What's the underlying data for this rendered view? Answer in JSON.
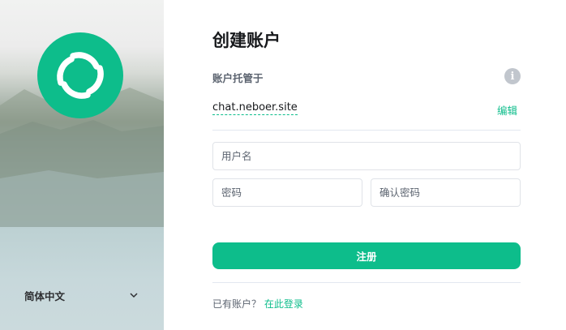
{
  "left_panel": {
    "logo_icon": "element-logo-icon",
    "language_label": "简体中文",
    "dropdown_icon": "chevron-down-icon"
  },
  "main": {
    "title": "创建账户",
    "homeserver_label": "账户托管于",
    "info_icon_glyph": "i",
    "homeserver_value": "chat.neboer.site",
    "edit_label": "编辑",
    "username_placeholder": "用户名",
    "password_placeholder": "密码",
    "confirm_password_placeholder": "确认密码",
    "register_label": "注册",
    "existing_account_text": "已有账户？",
    "login_link_text": "在此登录"
  },
  "colors": {
    "accent": "#0dbd8b",
    "info_icon_bg": "#c1c6cd",
    "text_primary": "#17191c",
    "text_secondary": "#5c6470"
  }
}
